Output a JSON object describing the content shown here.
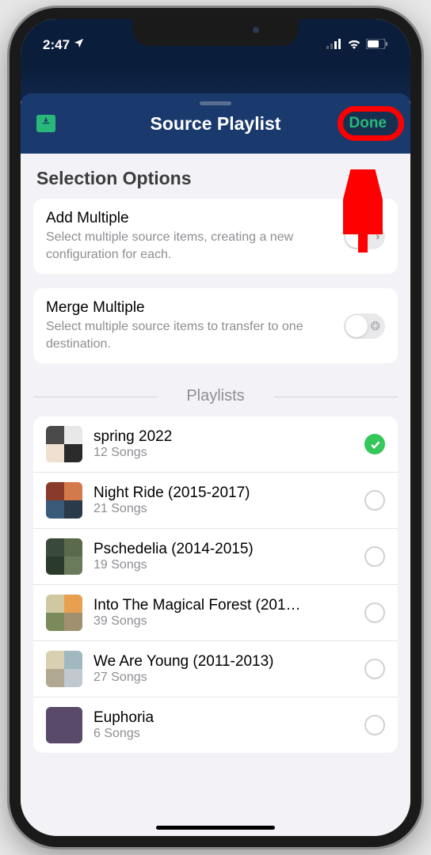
{
  "status": {
    "time": "2:47",
    "location_active": true
  },
  "header": {
    "title": "Source Playlist",
    "done_label": "Done"
  },
  "section_title": "Selection Options",
  "options": [
    {
      "title": "Add Multiple",
      "desc": "Select multiple source items, creating a new configuration for each.",
      "enabled": false
    },
    {
      "title": "Merge Multiple",
      "desc": "Select multiple source items to transfer to one destination.",
      "enabled": false
    }
  ],
  "list_header": "Playlists",
  "playlists": [
    {
      "name": "spring 2022",
      "count": "12 Songs",
      "selected": true,
      "colors": [
        "#4a4a4a",
        "#e8e8e8",
        "#f0e0d0",
        "#2a2a2a"
      ]
    },
    {
      "name": "Night Ride (2015-2017)",
      "count": "21 Songs",
      "selected": false,
      "colors": [
        "#8a3a2a",
        "#d47a4a",
        "#3a5a7a",
        "#2a3a4a"
      ]
    },
    {
      "name": "Pschedelia (2014-2015)",
      "count": "19 Songs",
      "selected": false,
      "colors": [
        "#3a4a3a",
        "#5a6a4a",
        "#2a3a2a",
        "#6a7a5a"
      ]
    },
    {
      "name": "Into The Magical Forest (201…",
      "count": "39 Songs",
      "selected": false,
      "colors": [
        "#d0c8a0",
        "#e8a050",
        "#7a8a5a",
        "#a09070"
      ]
    },
    {
      "name": "We Are Young (2011-2013)",
      "count": "27 Songs",
      "selected": false,
      "colors": [
        "#d8d0b0",
        "#a0b8c0",
        "#b0a890",
        "#c0c8d0"
      ]
    },
    {
      "name": "Euphoria",
      "count": "6 Songs",
      "selected": false,
      "colors": [
        "#5a4a6a"
      ]
    }
  ]
}
